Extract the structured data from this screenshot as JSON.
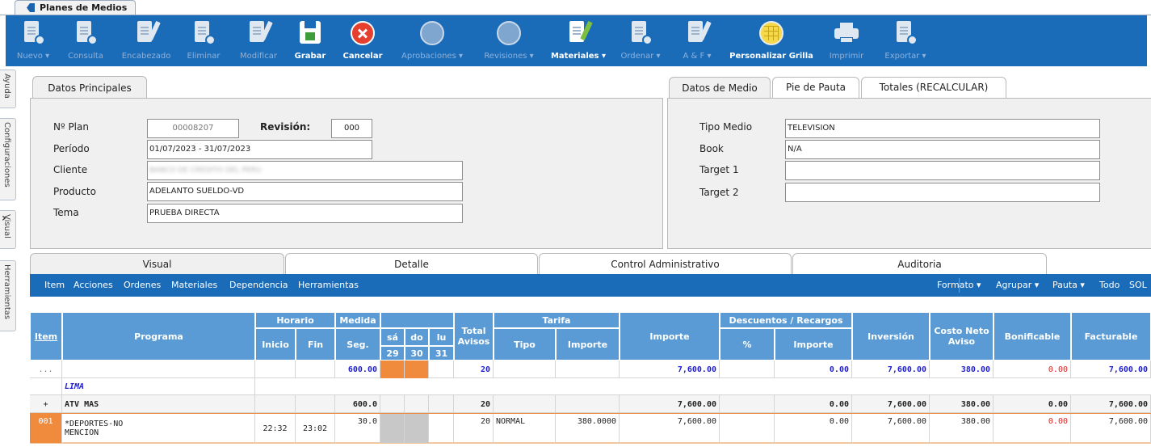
{
  "app_tab": {
    "label": "Planes de Medios"
  },
  "toolbar": [
    {
      "id": "nuevo",
      "label": "Nuevo ▾",
      "icon": "doc-add-icon",
      "enabled": false
    },
    {
      "id": "consulta",
      "label": "Consulta",
      "icon": "doc-query-icon",
      "enabled": false
    },
    {
      "id": "encabezado",
      "label": "Encabezado",
      "icon": "doc-edit-icon",
      "enabled": false
    },
    {
      "id": "eliminar",
      "label": "Eliminar",
      "icon": "doc-delete-icon",
      "enabled": false
    },
    {
      "id": "modificar",
      "label": "Modificar",
      "icon": "doc-edit-icon",
      "enabled": false
    },
    {
      "id": "grabar",
      "label": "Grabar",
      "icon": "save-icon",
      "enabled": true
    },
    {
      "id": "cancelar",
      "label": "Cancelar",
      "icon": "cancel-icon",
      "enabled": true
    },
    {
      "id": "aprobaciones",
      "label": "Aprobaciones ▾",
      "icon": "thumbs-up-icon",
      "enabled": false
    },
    {
      "id": "revisiones",
      "label": "Revisiones ▾",
      "icon": "thumbs-up-icon",
      "enabled": false
    },
    {
      "id": "materiales",
      "label": "Materiales ▾",
      "icon": "doc-edit-icon",
      "enabled": true
    },
    {
      "id": "ordenar",
      "label": "Ordenar ▾",
      "icon": "doc-add-icon",
      "enabled": false
    },
    {
      "id": "ayf",
      "label": "A & F ▾",
      "icon": "doc-edit-icon",
      "enabled": false
    },
    {
      "id": "personalizar",
      "label": "Personalizar Grilla",
      "icon": "grid-globe-icon",
      "enabled": true
    },
    {
      "id": "imprimir",
      "label": "Imprimir",
      "icon": "printer-icon",
      "enabled": false
    },
    {
      "id": "exportar",
      "label": "Exportar ▾",
      "icon": "doc-export-icon",
      "enabled": false
    }
  ],
  "side_tabs": [
    "Ayuda",
    "Configuraciones",
    "Visual",
    "Herramientas"
  ],
  "datos_principales": {
    "tab": "Datos Principales",
    "plan_label": "Nº Plan",
    "plan_value": "00008207",
    "revision_label": "Revisión:",
    "revision_value": "000",
    "periodo_label": "Período",
    "periodo_value": "01/07/2023 - 31/07/2023",
    "cliente_label": "Cliente",
    "cliente_value": "BANCO DE CREDITO DEL PERU",
    "producto_label": "Producto",
    "producto_value": "ADELANTO SUELDO-VD",
    "tema_label": "Tema",
    "tema_value": "PRUEBA DIRECTA"
  },
  "datos_medio": {
    "tabs": [
      "Datos de Medio",
      "Pie de Pauta",
      "Totales (RECALCULAR)"
    ],
    "tipo_label": "Tipo Medio",
    "tipo_value": "TELEVISION",
    "book_label": "Book",
    "book_value": "N/A",
    "target1_label": "Target 1",
    "target1_value": "",
    "target2_label": "Target 2",
    "target2_value": ""
  },
  "lower_tabs": [
    "Visual",
    "Detalle",
    "Control Administrativo",
    "Auditoria"
  ],
  "menu_left": [
    "Item",
    "Acciones",
    "Ordenes",
    "Materiales",
    "Dependencia",
    "Herramientas"
  ],
  "menu_right": [
    "Formato ▾",
    "Agrupar ▾",
    "Pauta ▾",
    "Todo",
    "SOL"
  ],
  "grid": {
    "headers": {
      "item": "Item",
      "programa": "Programa",
      "horario": "Horario",
      "inicio": "Inicio",
      "fin": "Fin",
      "medida": "Medida",
      "seg": "Seg.",
      "days": [
        "sá",
        "do",
        "lu"
      ],
      "dates": [
        "29",
        "30",
        "31"
      ],
      "total_avisos": "Total Avisos",
      "tarifa": "Tarifa",
      "tipo": "Tipo",
      "tarifa_importe": "Importe",
      "importe": "Importe",
      "desc": "Descuentos / Recargos",
      "pct": "%",
      "desc_importe": "Importe",
      "inversion": "Inversión",
      "costo": "Costo Neto Aviso",
      "bonificable": "Bonificable",
      "facturable": "Facturable"
    },
    "summary": {
      "item": "...",
      "seg": "600.00",
      "total": "20",
      "importe": "7,600.00",
      "desc_importe": "0.00",
      "inversion": "7,600.00",
      "costo": "380.00",
      "bonificable": "0.00",
      "facturable": "7,600.00"
    },
    "group_lima": "LIMA",
    "group_atv": {
      "item": "+",
      "programa": "ATV MAS",
      "seg": "600.0",
      "total": "20",
      "importe": "7,600.00",
      "desc_importe": "0.00",
      "inversion": "7,600.00",
      "costo": "380.00",
      "bonificable": "0.00",
      "facturable": "7,600.00"
    },
    "row1": {
      "item": "001",
      "programa1": "*DEPORTES-NO",
      "programa2": "MENCION",
      "inicio": "22:32",
      "fin": "23:02",
      "seg": "30.0",
      "total": "20",
      "tipo": "NORMAL",
      "tarifa_importe": "380.0000",
      "importe": "7,600.00",
      "desc_importe": "0.00",
      "inversion": "7,600.00",
      "costo": "380.00",
      "bonificable": "0.00",
      "facturable": "7,600.00"
    }
  },
  "colors": {
    "toolbar": "#1a6bb8",
    "header": "#5b9bd5",
    "accent": "#f08a3c",
    "link": "#1f1fcc",
    "negative": "#e02020"
  }
}
